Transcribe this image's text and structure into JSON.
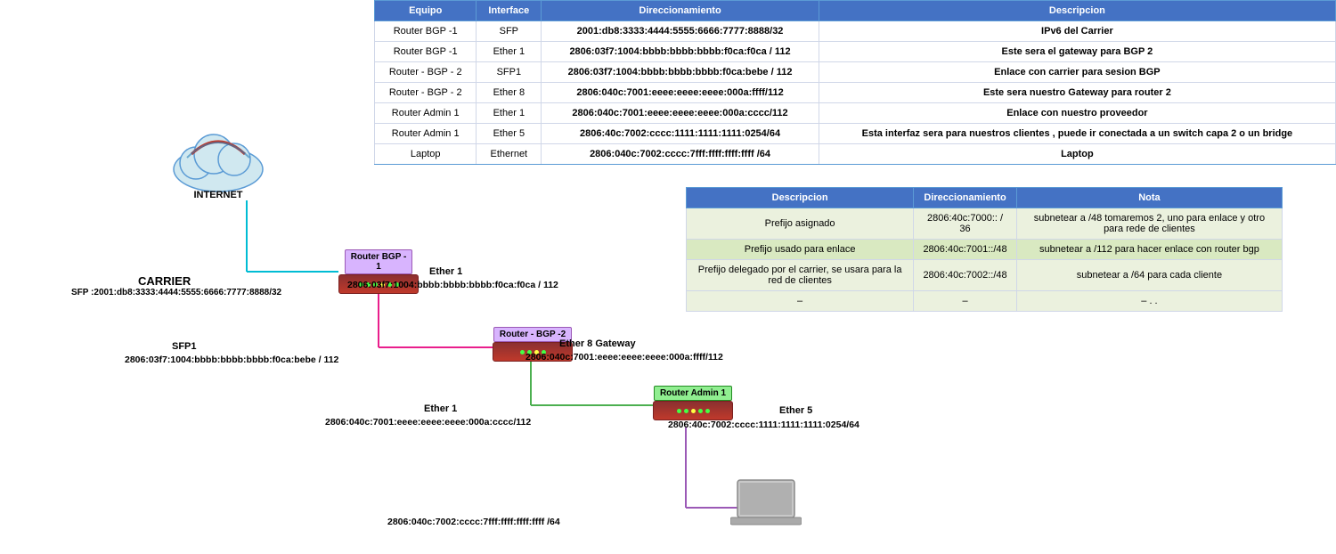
{
  "table": {
    "headers": [
      "Equipo",
      "Interface",
      "Direccionamiento",
      "Descripcion"
    ],
    "rows": [
      {
        "equipo": "Router BGP -1",
        "interface": "SFP",
        "direccionamiento": "2001:db8:3333:4444:5555:6666:7777:8888/32",
        "descripcion": "IPv6 del Carrier"
      },
      {
        "equipo": "Router BGP -1",
        "interface": "Ether 1",
        "direccionamiento": "2806:03f7:1004:bbbb:bbbb:bbbb:f0ca:f0ca / 112",
        "descripcion": "Este sera el gateway para BGP 2"
      },
      {
        "equipo": "Router - BGP - 2",
        "interface": "SFP1",
        "direccionamiento": "2806:03f7:1004:bbbb:bbbb:bbbb:f0ca:bebe / 112",
        "descripcion": "Enlace con carrier para sesion BGP"
      },
      {
        "equipo": "Router - BGP - 2",
        "interface": "Ether 8",
        "direccionamiento": "2806:040c:7001:eeee:eeee:eeee:000a:ffff/112",
        "descripcion": "Este sera nuestro Gateway para router 2"
      },
      {
        "equipo": "Router Admin 1",
        "interface": "Ether 1",
        "direccionamiento": "2806:040c:7001:eeee:eeee:eeee:000a:cccc/112",
        "descripcion": "Enlace con nuestro proveedor"
      },
      {
        "equipo": "Router Admin 1",
        "interface": "Ether 5",
        "direccionamiento": "2806:40c:7002:cccc:1111:1111:1111:0254/64",
        "descripcion": "Esta interfaz sera para nuestros clientes , puede ir conectada a un switch capa 2 o un bridge"
      },
      {
        "equipo": "Laptop",
        "interface": "Ethernet",
        "direccionamiento": "2806:040c:7002:cccc:7fff:ffff:ffff:ffff /64",
        "descripcion": "Laptop"
      }
    ]
  },
  "lower_table": {
    "headers": [
      "Descripcion",
      "Direccionamiento",
      "Nota"
    ],
    "rows": [
      {
        "descripcion": "Prefijo asignado",
        "direccionamiento": "2806:40c:7000:: / 36",
        "nota": "subnetear a /48  tomaremos 2, uno para enlace y otro para rede de clientes"
      },
      {
        "descripcion": "Prefijo usado para enlace",
        "direccionamiento": "2806:40c:7001::/48",
        "nota": "subnetear a /112 para hacer enlace con router bgp"
      },
      {
        "descripcion": "Prefijo delegado por el carrier, se usara para la red de clientes",
        "direccionamiento": "2806:40c:7002::/48",
        "nota": "subnetear a /64 para cada cliente"
      },
      {
        "descripcion": "–",
        "direccionamiento": "–",
        "nota": "– . ."
      }
    ]
  },
  "diagram": {
    "carrier_label": "CARRIER",
    "carrier_sfp": "SFP :2001:db8:3333:4444:5555:6666:7777:8888/32",
    "internet_label": "INTERNET",
    "router_bgp1_label": "Router BGP -\n1",
    "router_bgp1_ether1_label": "Ether 1",
    "router_bgp1_ether1_addr": "2806:03f7:1004:bbbb:bbbb:bbbb:f0ca:f0ca / 112",
    "router_bgp2_label": "Router - BGP -2",
    "router_bgp2_sfp1_label": "SFP1",
    "router_bgp2_sfp1_addr": "2806:03f7:1004:bbbb:bbbb:bbbb:f0ca:bebe / 112",
    "router_bgp2_ether8_label": "Ether 8 Gateway",
    "router_bgp2_ether8_addr": "2806:040c:7001:eeee:eeee:eeee:000a:ffff/112",
    "router_admin1_label": "Router Admin 1",
    "router_admin1_ether1_label": "Ether 1",
    "router_admin1_ether1_addr": "2806:040c:7001:eeee:eeee:eeee:000a:cccc/112",
    "router_admin1_ether5_label": "Ether 5",
    "router_admin1_ether5_addr": "2806:40c:7002:cccc:1111:1111:1111:0254/64",
    "laptop_addr": "2806:040c:7002:cccc:7fff:ffff:ffff:ffff /64"
  }
}
